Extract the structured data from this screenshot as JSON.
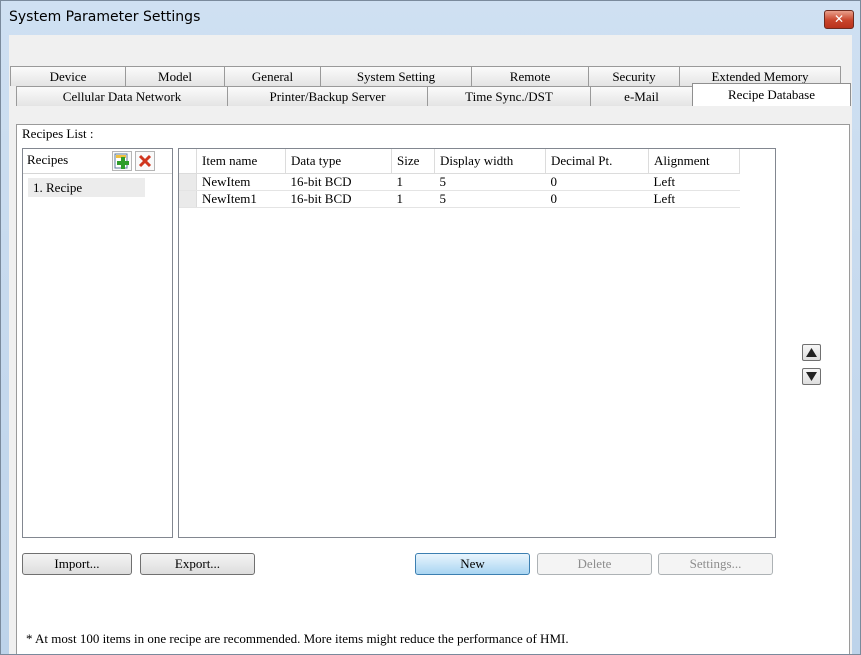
{
  "window": {
    "title": "System Parameter Settings",
    "close_label": "✕"
  },
  "tabs_row1": [
    "Device",
    "Model",
    "General",
    "System Setting",
    "Remote",
    "Security",
    "Extended Memory"
  ],
  "tabs_row2": [
    "Cellular Data Network",
    "Printer/Backup Server",
    "Time Sync./DST",
    "e-Mail",
    "Recipe Database"
  ],
  "active_tab": "Recipe Database",
  "recipes_list_label": "Recipes List :",
  "recipes_panel": {
    "header": "Recipes",
    "items": [
      "1. Recipe"
    ]
  },
  "grid": {
    "columns": [
      "Item name",
      "Data type",
      "Size",
      "Display width",
      "Decimal Pt.",
      "Alignment"
    ],
    "rows": [
      [
        "NewItem",
        "16-bit BCD",
        "1",
        "5",
        "0",
        "Left"
      ],
      [
        "NewItem1",
        "16-bit BCD",
        "1",
        "5",
        "0",
        "Left"
      ]
    ]
  },
  "buttons": {
    "import": "Import...",
    "export": "Export...",
    "new": "New",
    "delete": "Delete",
    "settings": "Settings..."
  },
  "footnote": "* At most 100 items in one recipe are recommended. More items might reduce the performance of HMI.",
  "colors": {
    "add_icon": "#2e9c2a",
    "delete_icon": "#d0361f",
    "default_button": "#a9d5f2"
  }
}
